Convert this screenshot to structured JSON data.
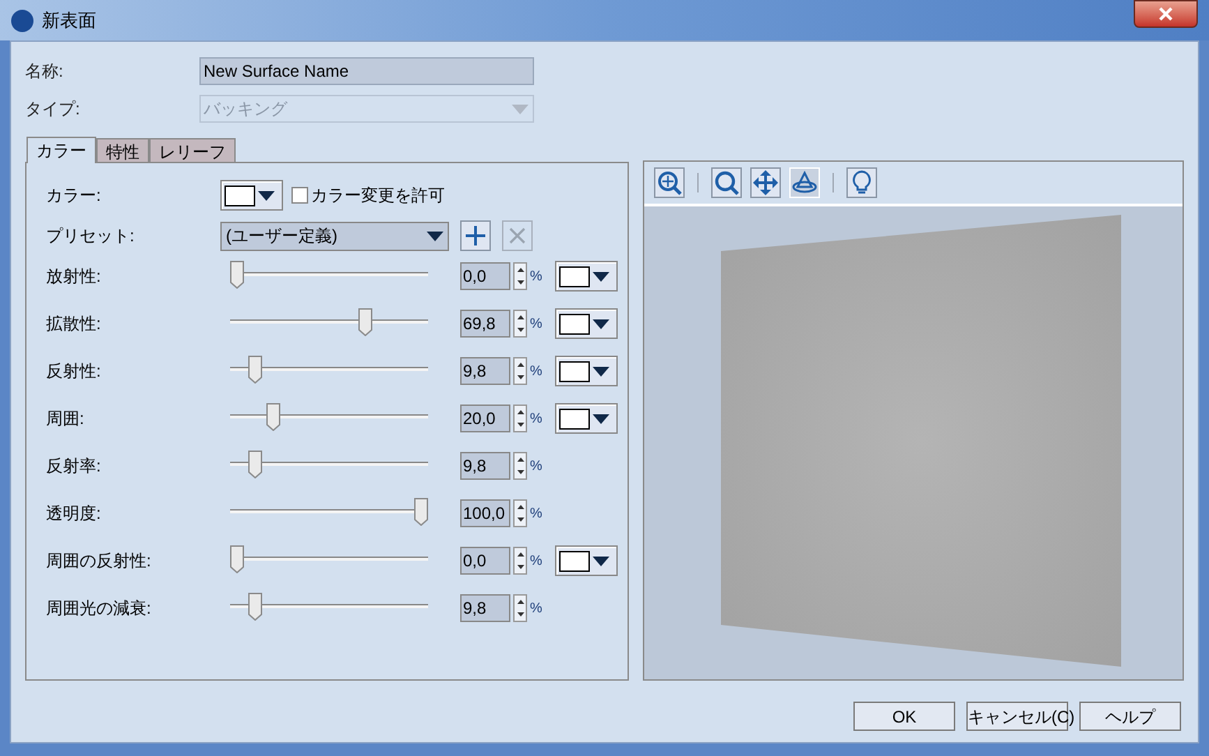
{
  "window": {
    "title": "新表面"
  },
  "name_field": {
    "label": "名称:",
    "value": "New Surface Name"
  },
  "type_field": {
    "label": "タイプ:",
    "value": "バッキング",
    "disabled": true
  },
  "tabs": [
    {
      "label": "カラー",
      "selected": true
    },
    {
      "label": "特性",
      "selected": false
    },
    {
      "label": "レリーフ",
      "selected": false
    }
  ],
  "color_row": {
    "label": "カラー:",
    "allow_change": {
      "label": "カラー変更を許可",
      "checked": false
    }
  },
  "preset_row": {
    "label": "プリセット:",
    "value": "(ユーザー定義)"
  },
  "sliders": [
    {
      "label": "放射性:",
      "level": 0,
      "reading": "0,0",
      "unit": "%",
      "swatch": true
    },
    {
      "label": "拡散性:",
      "level": 0.698,
      "reading": "69,8",
      "unit": "%",
      "swatch": true
    },
    {
      "label": "反射性:",
      "level": 0.098,
      "reading": "9,8",
      "unit": "%",
      "swatch": true
    },
    {
      "label": "周囲:",
      "level": 0.2,
      "reading": "20,0",
      "unit": "%",
      "swatch": true
    },
    {
      "label": "反射率:",
      "level": 0.098,
      "reading": "9,8",
      "unit": "%",
      "swatch": false
    },
    {
      "label": "透明度:",
      "level": 1,
      "reading": "100,0",
      "unit": "%",
      "swatch": false
    },
    {
      "label": "周囲の反射性:",
      "level": 0,
      "reading": "0,0",
      "unit": "%",
      "swatch": true
    },
    {
      "label": "周囲光の減衰:",
      "level": 0.098,
      "reading": "9,8",
      "unit": "%",
      "swatch": false
    }
  ],
  "preview_tools": [
    {
      "kind": "zoom-fit",
      "selected": false
    },
    {
      "kind": "separator"
    },
    {
      "kind": "zoom",
      "selected": false
    },
    {
      "kind": "pan",
      "selected": false
    },
    {
      "kind": "rotate",
      "selected": true
    },
    {
      "kind": "separator"
    },
    {
      "kind": "light",
      "selected": false
    }
  ],
  "buttons": [
    "OK",
    "キャンセル(C)",
    "ヘルプ"
  ]
}
